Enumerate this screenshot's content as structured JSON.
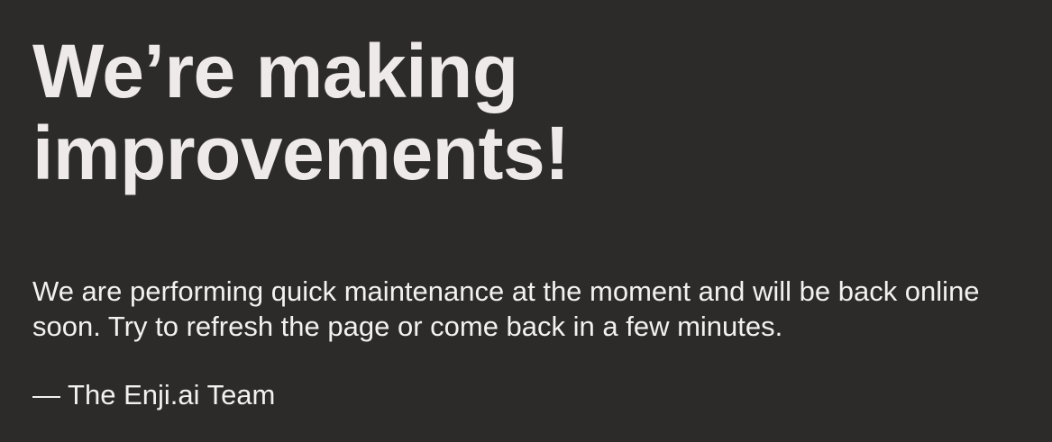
{
  "page": {
    "heading": "We’re making improvements!",
    "message": "We are performing quick maintenance at the moment and will be back online soon. Try to refresh the page or come back in a few minutes.",
    "signature": "— The Enji.ai Team"
  },
  "colors": {
    "background": "#2d2a2a",
    "text": "#f1eded"
  }
}
